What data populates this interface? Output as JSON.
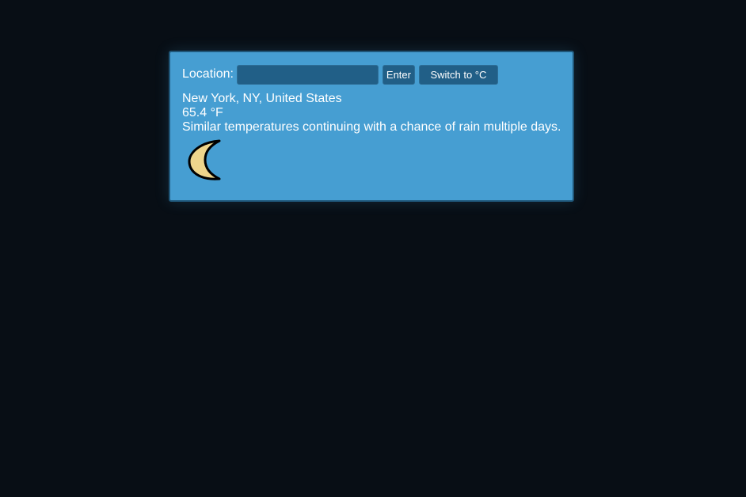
{
  "search": {
    "label": "Location:",
    "input_value": "",
    "input_placeholder": "",
    "enter_label": "Enter",
    "switch_label": "Switch to °C"
  },
  "weather": {
    "location": "New York, NY, United States",
    "temperature": "65.4 °F",
    "forecast": "Similar temperatures continuing with a chance of rain multiple days.",
    "icon": "moon-icon"
  },
  "colors": {
    "page_background": "#080e15",
    "card_background": "#469ed2",
    "control_background": "#215f87",
    "moon_fill": "#eed58c"
  }
}
